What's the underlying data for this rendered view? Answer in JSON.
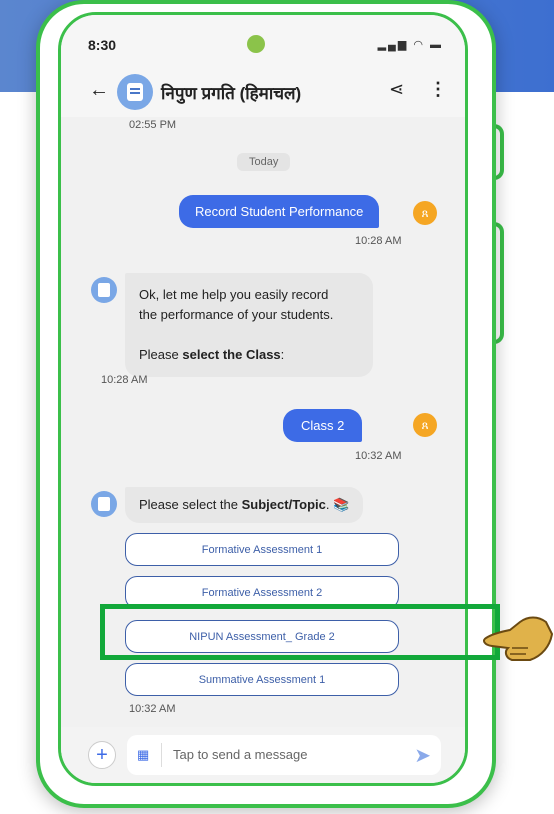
{
  "status_bar": {
    "time": "8:30"
  },
  "header": {
    "title": "निपुण प्रगति (हिमाचल)"
  },
  "chat": {
    "earlier_timestamp": "02:55 PM",
    "day_separator": "Today",
    "user_message_1": {
      "text": "Record Student Performance",
      "time": "10:28 AM"
    },
    "bot_message_1": {
      "line1": "Ok, let me help you easily record",
      "line2": "the performance of your students.",
      "line3_prefix": "Please ",
      "line3_bold": "select the Class",
      "line3_suffix": ":",
      "time": "10:28 AM"
    },
    "user_message_2": {
      "text": "Class 2",
      "time": "10:32 AM"
    },
    "bot_message_2": {
      "prefix": "Please select the ",
      "bold": "Subject/Topic",
      "suffix": ". 📚"
    },
    "options": [
      "Formative Assessment 1",
      "Formative Assessment 2",
      "NIPUN Assessment_ Grade 2",
      "Summative Assessment 1"
    ],
    "options_time": "10:32 AM"
  },
  "composer": {
    "placeholder": "Tap to send a message"
  },
  "colors": {
    "highlight": "#12a83a",
    "phone_outline": "#3bbf4a",
    "user_bubble": "#3d6be6"
  }
}
